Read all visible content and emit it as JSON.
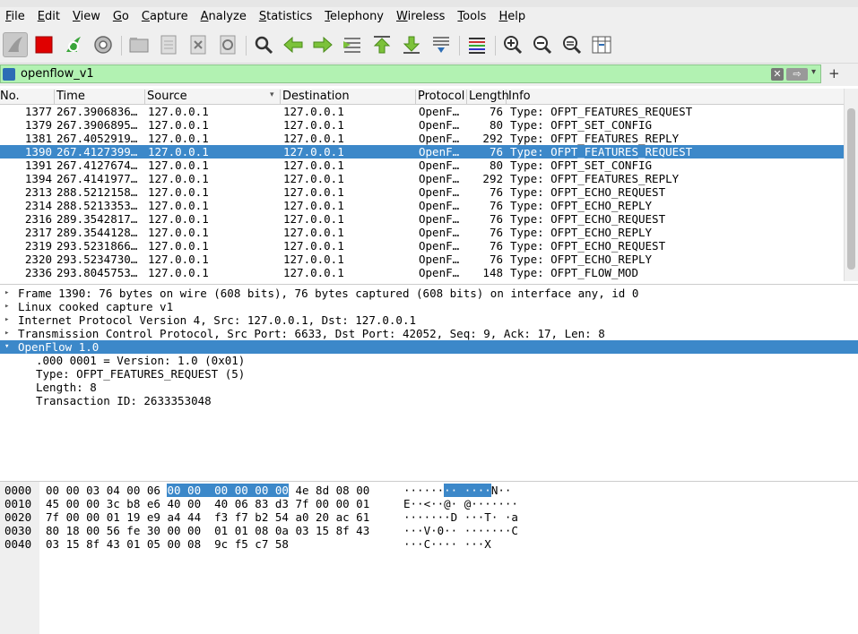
{
  "menu": [
    "File",
    "Edit",
    "View",
    "Go",
    "Capture",
    "Analyze",
    "Statistics",
    "Telephony",
    "Wireless",
    "Tools",
    "Help"
  ],
  "toolbar_icons": [
    "shark-fin-icon",
    "stop-icon",
    "restart-icon",
    "options-gear-icon",
    "open-file-icon",
    "save-file-icon",
    "close-file-icon",
    "reload-icon",
    "find-icon",
    "back-arrow-icon",
    "forward-arrow-icon",
    "go-to-packet-icon",
    "first-packet-icon",
    "last-packet-icon",
    "autoscroll-icon",
    "colorize-icon",
    "zoom-in-icon",
    "zoom-out-icon",
    "zoom-reset-icon",
    "resize-columns-icon"
  ],
  "filter": {
    "value": "openflow_v1"
  },
  "columns": [
    "No.",
    "Time",
    "Source",
    "Destination",
    "Protocol",
    "Length",
    "Info"
  ],
  "packets": [
    {
      "no": "1377",
      "time": "267.3906836…",
      "src": "127.0.0.1",
      "dst": "127.0.0.1",
      "proto": "OpenF…",
      "len": "76",
      "info": "Type: OFPT_FEATURES_REQUEST"
    },
    {
      "no": "1379",
      "time": "267.3906895…",
      "src": "127.0.0.1",
      "dst": "127.0.0.1",
      "proto": "OpenF…",
      "len": "80",
      "info": "Type: OFPT_SET_CONFIG"
    },
    {
      "no": "1381",
      "time": "267.4052919…",
      "src": "127.0.0.1",
      "dst": "127.0.0.1",
      "proto": "OpenF…",
      "len": "292",
      "info": "Type: OFPT_FEATURES_REPLY"
    },
    {
      "no": "1390",
      "time": "267.4127399…",
      "src": "127.0.0.1",
      "dst": "127.0.0.1",
      "proto": "OpenF…",
      "len": "76",
      "info": "Type: OFPT_FEATURES_REQUEST"
    },
    {
      "no": "1391",
      "time": "267.4127674…",
      "src": "127.0.0.1",
      "dst": "127.0.0.1",
      "proto": "OpenF…",
      "len": "80",
      "info": "Type: OFPT_SET_CONFIG"
    },
    {
      "no": "1394",
      "time": "267.4141977…",
      "src": "127.0.0.1",
      "dst": "127.0.0.1",
      "proto": "OpenF…",
      "len": "292",
      "info": "Type: OFPT_FEATURES_REPLY"
    },
    {
      "no": "2313",
      "time": "288.5212158…",
      "src": "127.0.0.1",
      "dst": "127.0.0.1",
      "proto": "OpenF…",
      "len": "76",
      "info": "Type: OFPT_ECHO_REQUEST"
    },
    {
      "no": "2314",
      "time": "288.5213353…",
      "src": "127.0.0.1",
      "dst": "127.0.0.1",
      "proto": "OpenF…",
      "len": "76",
      "info": "Type: OFPT_ECHO_REPLY"
    },
    {
      "no": "2316",
      "time": "289.3542817…",
      "src": "127.0.0.1",
      "dst": "127.0.0.1",
      "proto": "OpenF…",
      "len": "76",
      "info": "Type: OFPT_ECHO_REQUEST"
    },
    {
      "no": "2317",
      "time": "289.3544128…",
      "src": "127.0.0.1",
      "dst": "127.0.0.1",
      "proto": "OpenF…",
      "len": "76",
      "info": "Type: OFPT_ECHO_REPLY"
    },
    {
      "no": "2319",
      "time": "293.5231866…",
      "src": "127.0.0.1",
      "dst": "127.0.0.1",
      "proto": "OpenF…",
      "len": "76",
      "info": "Type: OFPT_ECHO_REQUEST"
    },
    {
      "no": "2320",
      "time": "293.5234730…",
      "src": "127.0.0.1",
      "dst": "127.0.0.1",
      "proto": "OpenF…",
      "len": "76",
      "info": "Type: OFPT_ECHO_REPLY"
    },
    {
      "no": "2336",
      "time": "293.8045753…",
      "src": "127.0.0.1",
      "dst": "127.0.0.1",
      "proto": "OpenF…",
      "len": "148",
      "info": "Type: OFPT_FLOW_MOD"
    }
  ],
  "selected_packet": "1390",
  "details": [
    {
      "text": "Frame 1390: 76 bytes on wire (608 bits), 76 bytes captured (608 bits) on interface any, id 0",
      "arrow": "▸"
    },
    {
      "text": "Linux cooked capture v1",
      "arrow": "▸"
    },
    {
      "text": "Internet Protocol Version 4, Src: 127.0.0.1, Dst: 127.0.0.1",
      "arrow": "▸"
    },
    {
      "text": "Transmission Control Protocol, Src Port: 6633, Dst Port: 42052, Seq: 9, Ack: 17, Len: 8",
      "arrow": "▸"
    },
    {
      "text": "OpenFlow 1.0",
      "arrow": "▾"
    },
    {
      "text": ".000 0001 = Version: 1.0 (0x01)",
      "arrow": ""
    },
    {
      "text": "Type: OFPT_FEATURES_REQUEST (5)",
      "arrow": ""
    },
    {
      "text": "Length: 8",
      "arrow": ""
    },
    {
      "text": "Transaction ID: 2633353048",
      "arrow": ""
    }
  ],
  "bytes": [
    {
      "off": "0000",
      "hex_pre": "00 00 03 04 00 06 ",
      "hex_hl": "00 00  00 00 00 00",
      "hex_post": " 4e 8d 08 00",
      "asc_pre": "······",
      "asc_hl": "·· ····",
      "asc_post": "N··"
    },
    {
      "off": "0010",
      "hex_pre": "45 00 00 3c b8 e6 40 00  40 06 83 d3 7f 00 00 01",
      "hex_hl": "",
      "hex_post": "",
      "asc_pre": "E··<··@· @·······",
      "asc_hl": "",
      "asc_post": ""
    },
    {
      "off": "0020",
      "hex_pre": "7f 00 00 01 19 e9 a4 44  f3 f7 b2 54 a0 20 ac 61",
      "hex_hl": "",
      "hex_post": "",
      "asc_pre": "·······D ···T· ·a",
      "asc_hl": "",
      "asc_post": ""
    },
    {
      "off": "0030",
      "hex_pre": "80 18 00 56 fe 30 00 00  01 01 08 0a 03 15 8f 43",
      "hex_hl": "",
      "hex_post": "",
      "asc_pre": "···V·0·· ·······C",
      "asc_hl": "",
      "asc_post": ""
    },
    {
      "off": "0040",
      "hex_pre": "03 15 8f 43 01 05 00 08  9c f5 c7 58",
      "hex_hl": "",
      "hex_post": "",
      "asc_pre": "···C···· ···X",
      "asc_hl": "",
      "asc_post": ""
    }
  ],
  "colors": {
    "selection": "#3c88c9",
    "filter_ok": "#b2f2b2"
  }
}
